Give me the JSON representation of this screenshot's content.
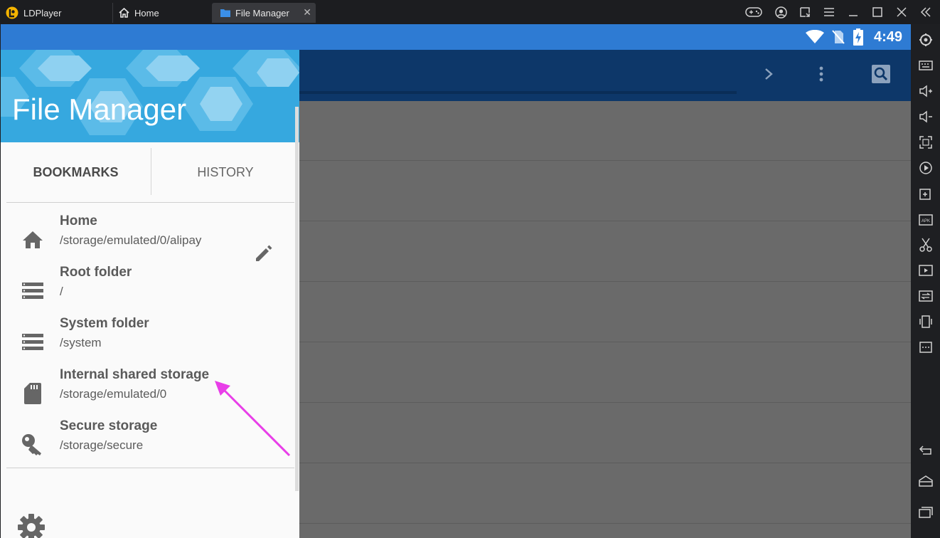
{
  "titlebar": {
    "app_name": "LDPlayer",
    "tabs": [
      {
        "label": "Home",
        "icon": "home-icon"
      },
      {
        "label": "File Manager",
        "icon": "folder-icon",
        "active": true
      }
    ],
    "controls": [
      "gamepad-icon",
      "account-icon",
      "screen-capture-icon",
      "menu-icon",
      "minimize-icon",
      "maximize-icon",
      "close-icon",
      "collapse-sidebar-icon"
    ]
  },
  "android": {
    "status": {
      "time": "4:49",
      "icons": [
        "wifi-icon",
        "no-sim-icon",
        "battery-charging-icon"
      ]
    },
    "toolbar_icons": [
      "chevron-right-icon",
      "more-vert-icon",
      "search-icon"
    ]
  },
  "drawer": {
    "title": "File Manager",
    "tabs": [
      {
        "label": "BOOKMARKS",
        "active": true
      },
      {
        "label": "HISTORY"
      }
    ],
    "bookmarks": [
      {
        "name": "Home",
        "path": "/storage/emulated/0/alipay",
        "icon": "home-icon"
      },
      {
        "name": "Root folder",
        "path": "/",
        "icon": "storage-list-icon"
      },
      {
        "name": "System folder",
        "path": "/system",
        "icon": "storage-list-icon"
      },
      {
        "name": "Internal shared storage",
        "path": "/storage/emulated/0",
        "icon": "sd-card-icon"
      },
      {
        "name": "Secure storage",
        "path": "/storage/secure",
        "icon": "key-icon"
      }
    ],
    "edit_icon": "pencil-icon",
    "settings_icon": "gear-icon"
  },
  "annotation": {
    "color": "#e83ee8",
    "icon": "arrow-annotation"
  },
  "rightbar": {
    "icons": [
      "settings-icon",
      "keyboard-icon",
      "volume-up-icon",
      "volume-down-icon",
      "fullscreen-icon",
      "record-icon",
      "add-window-icon",
      "apk-icon",
      "scissors-icon",
      "video-icon",
      "sync-icon",
      "shake-icon",
      "more-icon",
      "back-icon",
      "home-icon",
      "recents-icon"
    ]
  },
  "colors": {
    "statusbar": "#2e7bd3",
    "toolbar": "#0d3769",
    "drawer_header": "#36a8df"
  }
}
